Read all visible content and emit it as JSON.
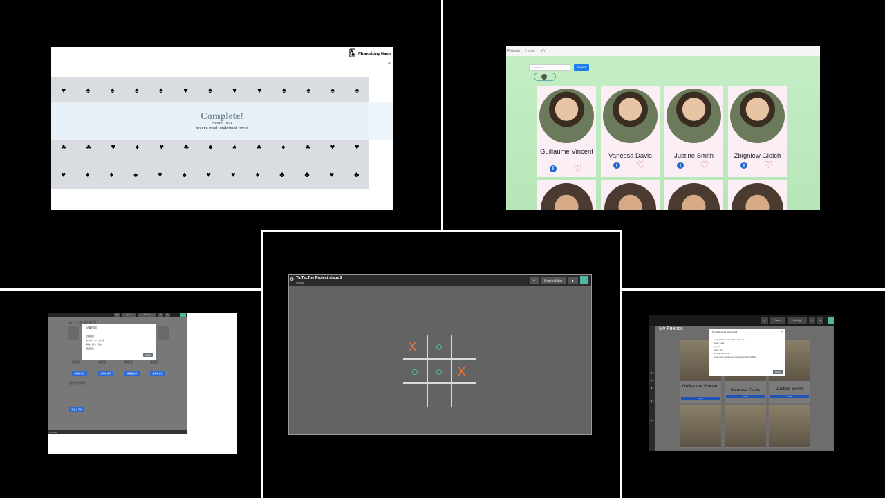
{
  "memorizing": {
    "app_title": "Memorizing Game",
    "logo_icon": "playing-cards-icon",
    "complete": "Complete!",
    "score": "Score: 260",
    "tries": "You've tried: undefined times",
    "rows": [
      [
        "♥",
        "♠",
        "♠",
        "♠",
        "♠",
        "♥",
        "♠",
        "♥",
        "♥",
        "♠",
        "♠",
        "♠",
        "♠"
      ],
      [
        "♣",
        "♣",
        "♣",
        "♣",
        "♣",
        "♣",
        "♣",
        "♣",
        "♥",
        "♣",
        "♦",
        "♦",
        "♦"
      ],
      [
        "♣",
        "♣",
        "♥",
        "♦",
        "♥",
        "♣",
        "♦",
        "♠",
        "♣",
        "♦",
        "♣",
        "♥",
        "♥"
      ],
      [
        "♥",
        "♦",
        "♦",
        "♠",
        "♥",
        "♠",
        "♥",
        "♥",
        "♦",
        "♣",
        "♣",
        "♥",
        "♣"
      ]
    ]
  },
  "friends": {
    "nav": {
      "brand": "Friends",
      "home": "Home",
      "my": "MY"
    },
    "search": {
      "placeholder": "Keyword...",
      "button": "Search"
    },
    "cards": [
      {
        "name": "Guillaume Vincent"
      },
      {
        "name": "Vanessa Davis"
      },
      {
        "name": "Justine Smith"
      },
      {
        "name": "Zbigniew Gleich"
      }
    ],
    "info_icon": "i",
    "heart_icon": "♡",
    "accent": "#1c66cf"
  },
  "japanese": {
    "title": "AC10子 診察所",
    "dialog_title": "記事内容",
    "dialog_lines": [
      "記載確認",
      "体が重くなっている",
      "栄養を摂って休む",
      "経過観察"
    ],
    "close": "Close",
    "labels": [
      "美容室",
      "美容室",
      "美容室",
      "美容室"
    ],
    "section": "個別予約表示",
    "buttons": [
      "詳細を表示",
      "詳細を表示",
      "詳細を表示",
      "詳細を表示"
    ],
    "bottom_button": "再送を予約",
    "footer": "Console"
  },
  "tictactoe": {
    "title": "TicTacToe Project stage 2",
    "subtitle": "Follow",
    "header_button": "Share in Editor",
    "board": [
      [
        "X",
        "O",
        ""
      ],
      [
        "O",
        "O",
        "X"
      ],
      [
        "",
        "",
        ""
      ]
    ],
    "x_color": "#e8733a",
    "o_color": "#4ec2a0"
  },
  "my_friends": {
    "title": "My Friends",
    "toolbar": {
      "save": "Save",
      "settings": "Settings"
    },
    "dialog": {
      "title": "Guillaume Vincent",
      "lines": [
        "email: guillaume.vincent@example.com",
        "gender: male",
        "age: 25",
        "region: CH",
        "birthday: 1995-05-10",
        "avatar: https://randomuser.me/api/portraits/men/95.jpg"
      ],
      "close": "Close"
    },
    "cards": [
      {
        "name": "Guillaume Vincent",
        "button": "Detail"
      },
      {
        "name": "Vanessa Davis",
        "button": "Detail"
      },
      {
        "name": "Justine Smith",
        "button": "Detail"
      }
    ]
  }
}
